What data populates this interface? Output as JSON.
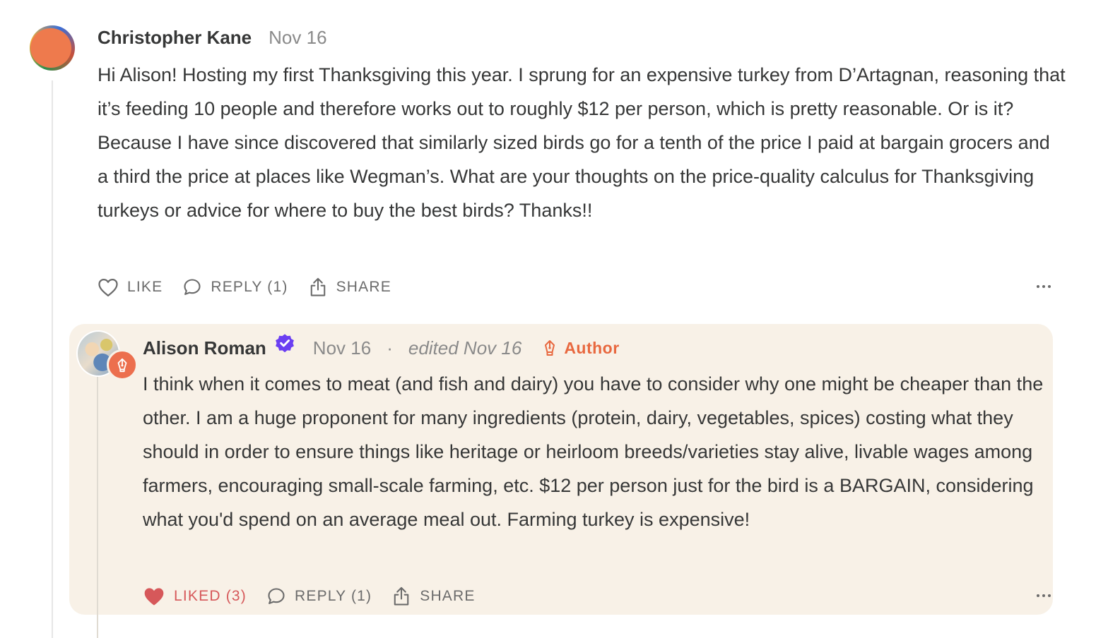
{
  "comments": [
    {
      "author": "Christopher Kane",
      "date": "Nov 16",
      "body": "Hi Alison! Hosting my first Thanksgiving this year. I sprung for an expensive turkey from D’Artagnan, reasoning that it’s feeding 10 people and therefore works out to roughly $12 per person, which is pretty reasonable. Or is it? Because I have since discovered that similarly sized birds go for a tenth of the price I paid at bargain grocers and a third the price at places like Wegman’s. What are your thoughts on the price-quality calculus for Thanksgiving turkeys or advice for where to buy the best birds? Thanks!!",
      "actions": {
        "like_label": "LIKE",
        "reply_label": "REPLY (1)",
        "share_label": "SHARE"
      }
    },
    {
      "author": "Alison Roman",
      "date": "Nov 16",
      "separator": "·",
      "edited": "edited Nov 16",
      "author_tag": "Author",
      "body": "I think when it comes to meat (and fish and dairy) you have to consider why one might be cheaper than the other. I am a huge proponent for many ingredients (protein, dairy, vegetables, spices) costing what they should in order to ensure things like heritage or heirloom breeds/varieties stay alive, livable wages among farmers, encouraging small-scale farming, etc. $12 per person just for the bird is a BARGAIN, considering what you'd spend on an average meal out. Farming turkey is expensive!",
      "actions": {
        "like_label": "LIKED (3)",
        "reply_label": "REPLY (1)",
        "share_label": "SHARE"
      }
    }
  ],
  "colors": {
    "reply_background": "#f8f1e7",
    "author_accent": "#e8683f",
    "verified": "#6b3ff2",
    "liked_heart": "#d6585a"
  },
  "icons": [
    "heart-icon",
    "comment-bubble-icon",
    "share-icon",
    "more-icon",
    "verified-badge-icon",
    "fountain-pen-icon"
  ]
}
